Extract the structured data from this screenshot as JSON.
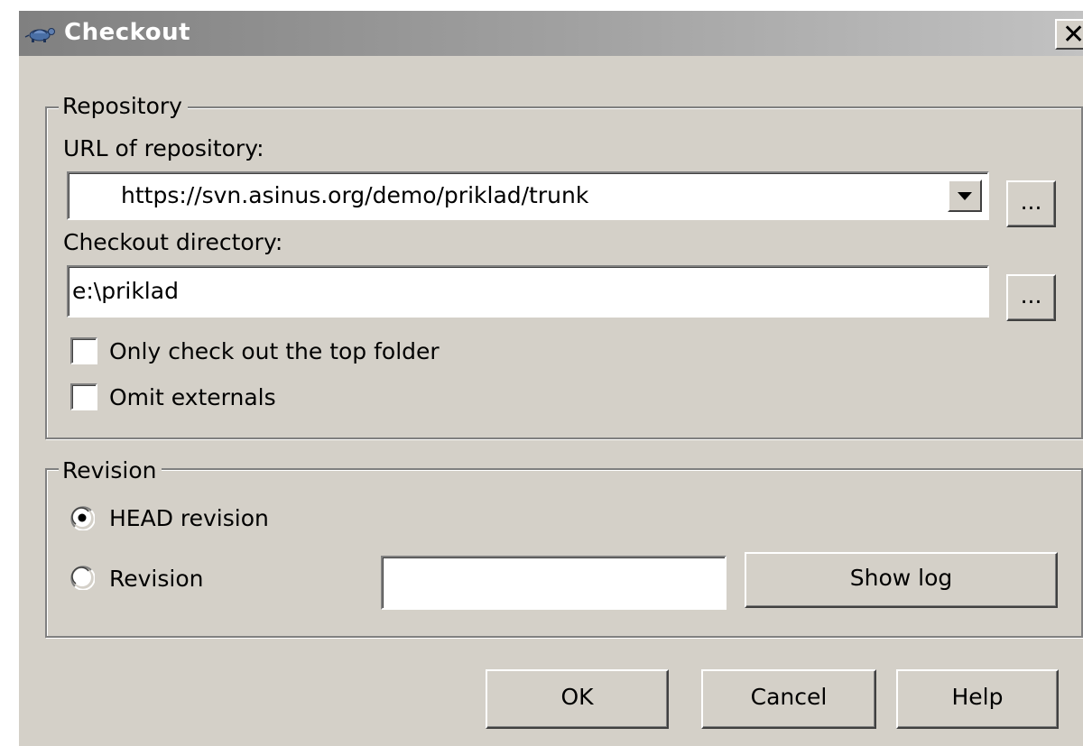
{
  "window": {
    "title": "Checkout",
    "close_glyph": "✕"
  },
  "repository": {
    "group_label": "Repository",
    "url_label": "URL of repository:",
    "url_value": "https://svn.asinus.org/demo/priklad/trunk",
    "url_browse_label": "...",
    "directory_label": "Checkout directory:",
    "directory_value": "e:\\priklad",
    "directory_browse_label": "...",
    "only_top_folder_label": "Only check out the top folder",
    "only_top_folder_checked": false,
    "omit_externals_label": "Omit externals",
    "omit_externals_checked": false
  },
  "revision": {
    "group_label": "Revision",
    "head_label": "HEAD revision",
    "head_selected": true,
    "revision_label": "Revision",
    "revision_selected": false,
    "revision_value": "",
    "show_log_label": "Show log"
  },
  "buttons": {
    "ok_label": "OK",
    "cancel_label": "Cancel",
    "help_label": "Help"
  },
  "icons": {
    "app": "tortoise-icon",
    "close": "close-icon",
    "dropdown": "dropdown-arrow-icon"
  },
  "colors": {
    "dialog_face": "#d4d0c8",
    "titlebar_start": "#808080",
    "titlebar_end": "#c2c2c2",
    "title_text": "#ffffff"
  }
}
